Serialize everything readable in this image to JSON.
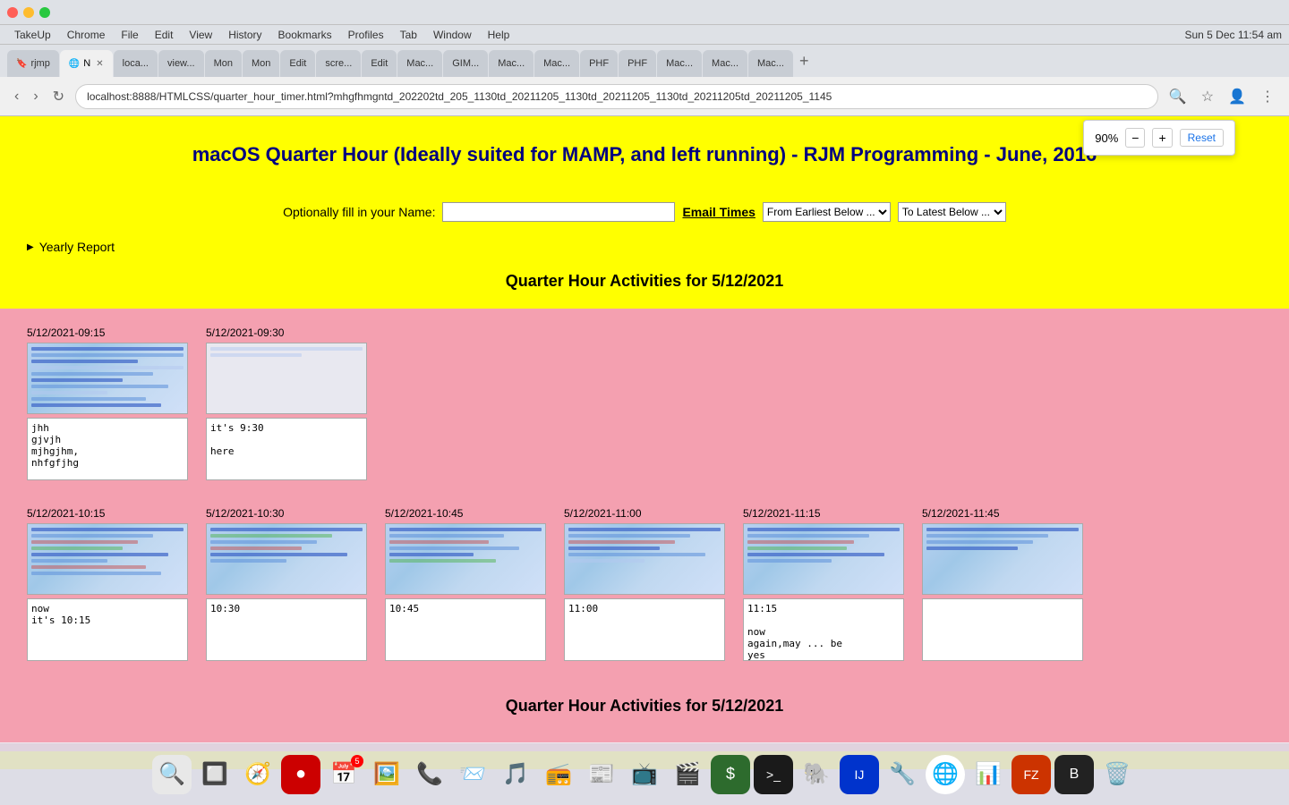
{
  "window": {
    "title": "macOS Quarter Hour (Ideally suited for MAMP, and left running) - RJM Programming - June, 2016",
    "zoom_level": "90%",
    "zoom_minus": "−",
    "zoom_plus": "+",
    "zoom_reset": "Reset",
    "datetime": "Sun 5 Dec  11:54 am"
  },
  "address_bar": {
    "url": "localhost:8888/HTMLCSS/quarter_hour_timer.html?mhgfhmgntd_202202td_205_1130td_20211205_1130td_20211205_1130td_20211205td_20211205_1145"
  },
  "menu": {
    "items": [
      "TakeUp",
      "Chrome",
      "File",
      "Edit",
      "View",
      "History",
      "Bookmarks",
      "Profiles",
      "Tab",
      "Window",
      "Help"
    ]
  },
  "tabs": [
    {
      "label": "rjmp",
      "active": false
    },
    {
      "label": "N ×",
      "active": true
    },
    {
      "label": "loca...",
      "active": false
    },
    {
      "label": "view...",
      "active": false
    },
    {
      "label": "Mon",
      "active": false
    },
    {
      "label": "Mon",
      "active": false
    },
    {
      "label": "Edit",
      "active": false
    },
    {
      "label": "scre...",
      "active": false
    },
    {
      "label": "Edit",
      "active": false
    },
    {
      "label": "Mac...",
      "active": false
    },
    {
      "label": "GIM...",
      "active": false
    },
    {
      "label": "Mac...",
      "active": false
    },
    {
      "label": "Mac...",
      "active": false
    },
    {
      "label": "PHF",
      "active": false
    },
    {
      "label": "PHF",
      "active": false
    },
    {
      "label": "Mac...",
      "active": false
    },
    {
      "label": "Mac...",
      "active": false
    },
    {
      "label": "Mac...",
      "active": false
    }
  ],
  "page": {
    "title": "macOS Quarter Hour (Ideally suited for MAMP, and left running) - RJM Programming - June, 2016",
    "form": {
      "name_label": "Optionally fill in your Name:",
      "name_placeholder": "",
      "email_times_label": "Email Times",
      "from_earliest_label": "From Earliest Below ...",
      "to_latest_label": "To Latest Below ..."
    },
    "yearly_report": "Yearly Report",
    "section_title": "Quarter Hour Activities for 5/12/2021",
    "footer_title": "Quarter Hour Activities for 5/12/2021",
    "activities": [
      {
        "timestamp": "5/12/2021-09:15",
        "screenshot_style": "code1",
        "notes": "jhh\ngjvjh\nmjhgjhm,\nnhfgfjhg"
      },
      {
        "timestamp": "5/12/2021-09:30",
        "screenshot_style": "blank",
        "notes": "it's 9:30\n\nhere"
      },
      {
        "timestamp": "5/12/2021-10:15",
        "screenshot_style": "code2",
        "notes": "now\nit's 10:15"
      },
      {
        "timestamp": "5/12/2021-10:30",
        "screenshot_style": "code3",
        "notes": "10:30"
      },
      {
        "timestamp": "5/12/2021-10:45",
        "screenshot_style": "code4",
        "notes": "10:45"
      },
      {
        "timestamp": "5/12/2021-11:00",
        "screenshot_style": "code5",
        "notes": "11:00"
      },
      {
        "timestamp": "5/12/2021-11:15",
        "screenshot_style": "code6",
        "notes": "11:15\n\nnow\nagain,may ... be\nyes"
      },
      {
        "timestamp": "5/12/2021-11:45",
        "screenshot_style": "code7",
        "notes": ""
      }
    ]
  },
  "dock": {
    "items": [
      {
        "icon": "🔍",
        "name": "finder"
      },
      {
        "icon": "🔲",
        "name": "launchpad"
      },
      {
        "icon": "🧭",
        "name": "safari"
      },
      {
        "icon": "🔴",
        "name": "app1",
        "badge": ""
      },
      {
        "icon": "📅",
        "name": "calendar",
        "badge": "5"
      },
      {
        "icon": "📷",
        "name": "photos"
      },
      {
        "icon": "📞",
        "name": "facetime"
      },
      {
        "icon": "📨",
        "name": "mail",
        "badge": ""
      },
      {
        "icon": "🎵",
        "name": "music"
      },
      {
        "icon": "📻",
        "name": "podcasts"
      },
      {
        "icon": "📰",
        "name": "news"
      },
      {
        "icon": "📺",
        "name": "appletv"
      },
      {
        "icon": "🎬",
        "name": "quicktime"
      },
      {
        "icon": "💰",
        "name": "app2"
      },
      {
        "icon": "⌨️",
        "name": "terminal"
      },
      {
        "icon": "🐘",
        "name": "postgres"
      },
      {
        "icon": "💻",
        "name": "app3"
      },
      {
        "icon": "🔧",
        "name": "tools"
      },
      {
        "icon": "🌐",
        "name": "chrome"
      },
      {
        "icon": "📊",
        "name": "stats"
      },
      {
        "icon": "📁",
        "name": "filezilla"
      },
      {
        "icon": "⚙️",
        "name": "app4"
      },
      {
        "icon": "🗑️",
        "name": "trash"
      }
    ]
  }
}
